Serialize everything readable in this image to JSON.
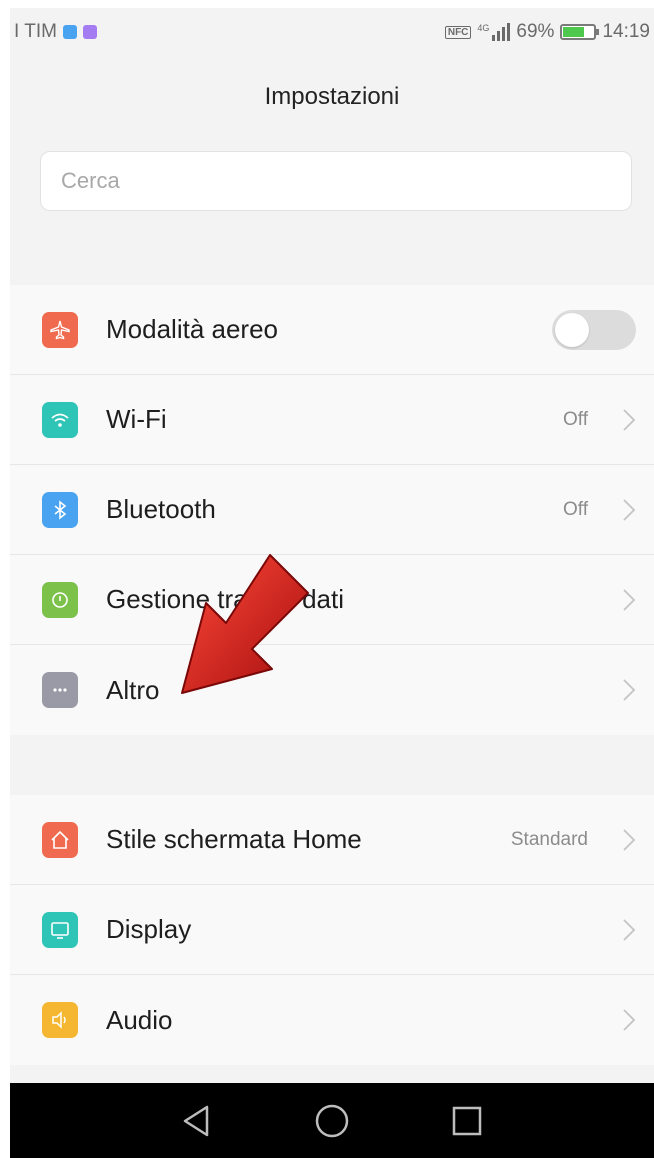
{
  "status_bar": {
    "carrier": "I TIM",
    "nfc": "NFC",
    "network": "4G",
    "battery": "69%",
    "battery_level": 0.69,
    "time": "14:19"
  },
  "header": {
    "title": "Impostazioni"
  },
  "search": {
    "placeholder": "Cerca"
  },
  "group1": [
    {
      "label": "Modalità aereo",
      "icon": "airplane-icon",
      "color": "#f06a4f",
      "control": "toggle",
      "toggle_on": false
    },
    {
      "label": "Wi-Fi",
      "icon": "wifi-icon",
      "color": "#2ec4b6",
      "value": "Off"
    },
    {
      "label": "Bluetooth",
      "icon": "bluetooth-icon",
      "color": "#4aa3f0",
      "value": "Off"
    },
    {
      "label": "Gestione traffico dati",
      "icon": "data-traffic-icon",
      "color": "#7cc14a",
      "value": ""
    },
    {
      "label": "Altro",
      "icon": "more-icon",
      "color": "#9a9aa6",
      "value": ""
    }
  ],
  "group2": [
    {
      "label": "Stile schermata Home",
      "icon": "home-icon",
      "color": "#f06a4f",
      "value": "Standard"
    },
    {
      "label": "Display",
      "icon": "display-icon",
      "color": "#2ec4b6",
      "value": ""
    },
    {
      "label": "Audio",
      "icon": "audio-icon",
      "color": "#f5b731",
      "value": ""
    }
  ],
  "nav": [
    "back-icon",
    "home-circle-icon",
    "recents-icon"
  ],
  "annotation": {
    "type": "red-arrow",
    "color": "#d91a1a",
    "points_to": "Altro"
  }
}
